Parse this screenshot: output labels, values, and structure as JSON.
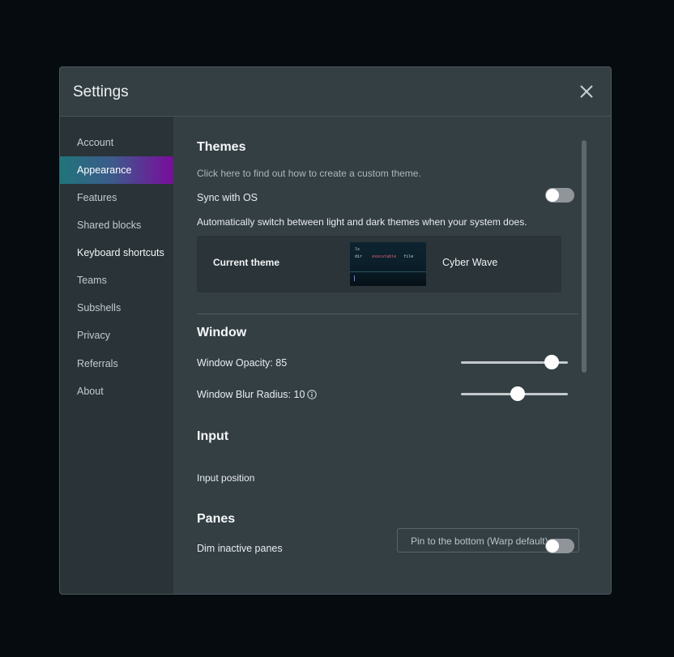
{
  "dialog": {
    "title": "Settings",
    "close_icon": "close-icon"
  },
  "sidebar": {
    "items": [
      {
        "label": "Account"
      },
      {
        "label": "Appearance",
        "active": true
      },
      {
        "label": "Features"
      },
      {
        "label": "Shared blocks"
      },
      {
        "label": "Keyboard shortcuts"
      },
      {
        "label": "Teams"
      },
      {
        "label": "Subshells"
      },
      {
        "label": "Privacy"
      },
      {
        "label": "Referrals"
      },
      {
        "label": "About"
      }
    ]
  },
  "themes": {
    "title": "Themes",
    "custom_theme_link": "Click here to find out how to create a custom theme.",
    "sync_label": "Sync with OS",
    "sync_enabled": false,
    "sync_description": "Automatically switch between light and dark themes when your system does.",
    "current_theme_label": "Current theme",
    "current_theme_name": "Cyber Wave",
    "preview": {
      "line1": "ls",
      "line2_a": "dir",
      "line2_b": "executable",
      "line2_c": "file"
    }
  },
  "window": {
    "title": "Window",
    "opacity_label": "Window Opacity: 85",
    "opacity_value": 85,
    "blur_label": "Window Blur Radius: 10",
    "blur_value": 10,
    "info_icon": "info-icon"
  },
  "input": {
    "title": "Input",
    "position_label": "Input position",
    "position_value": "Pin to the bottom (Warp default)",
    "chevron_icon": "chevron-down-icon"
  },
  "panes": {
    "title": "Panes",
    "dim_label": "Dim inactive panes",
    "dim_enabled": false
  },
  "colors": {
    "background": "#050b0f",
    "dialog": "#343f44",
    "sidebar": "#2a3337",
    "active_gradient_start": "#20747a",
    "active_gradient_end": "#7a0c9c"
  }
}
